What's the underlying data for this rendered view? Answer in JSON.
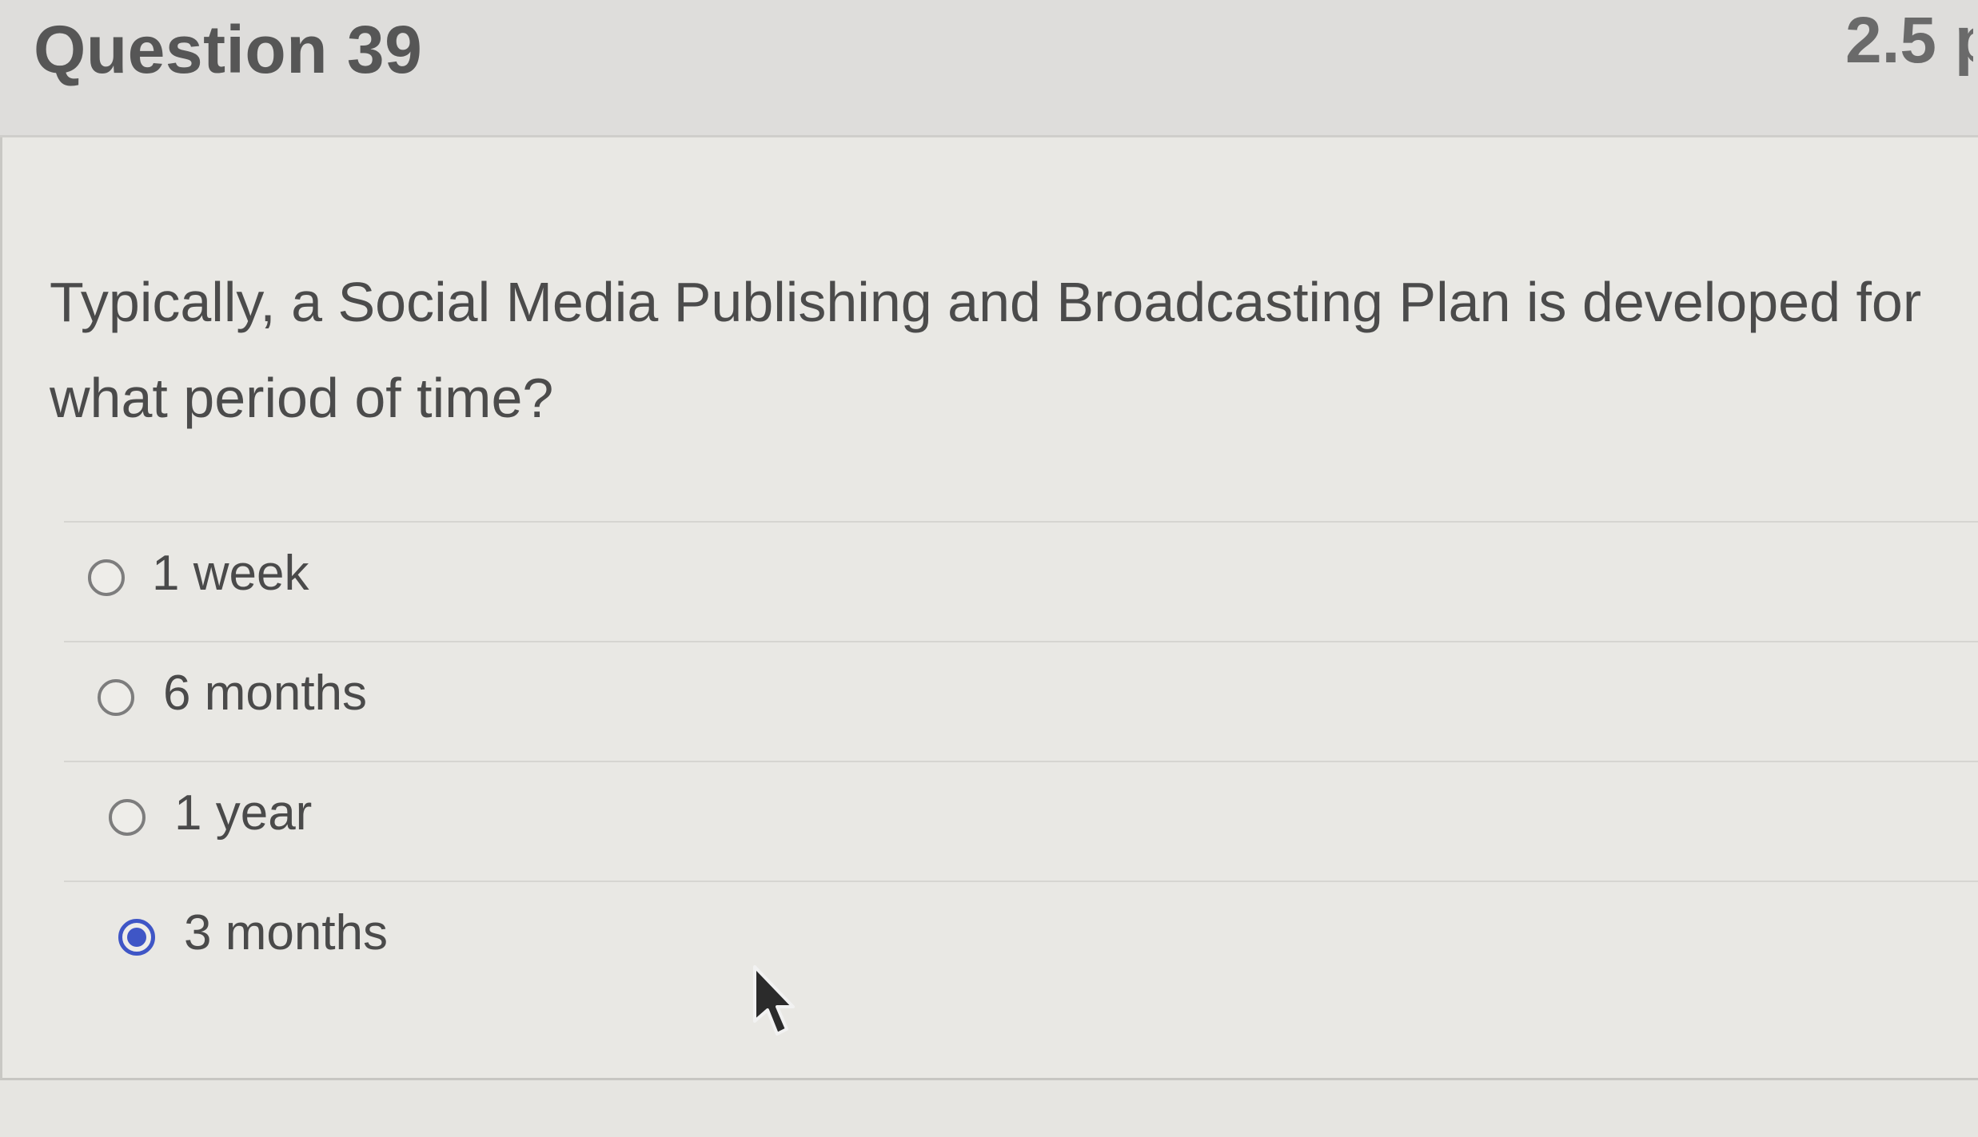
{
  "question": {
    "title": "Question 39",
    "points": "2.5 p",
    "prompt": "Typically, a Social Media Publishing and Broadcasting Plan is developed for what period of time?"
  },
  "answers": [
    {
      "label": "1 week",
      "selected": false
    },
    {
      "label": "6 months",
      "selected": false
    },
    {
      "label": "1 year",
      "selected": false
    },
    {
      "label": "3 months",
      "selected": true
    }
  ],
  "colors": {
    "accent": "#3f56c6",
    "background": "#e6e5e1",
    "text": "#4a4a4a"
  },
  "icons": {
    "cursor": "mouse-pointer-icon",
    "radio_unchecked": "radio-unchecked-icon",
    "radio_checked": "radio-checked-icon"
  }
}
